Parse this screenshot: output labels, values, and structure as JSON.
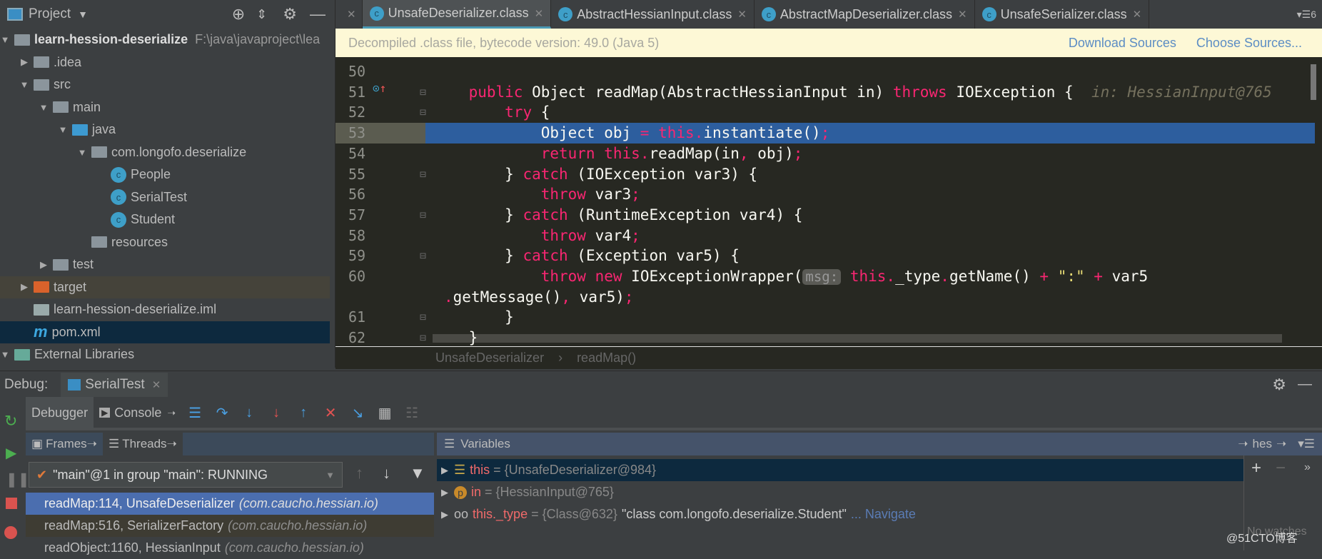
{
  "project": {
    "title": "Project",
    "tree": [
      {
        "label": "learn-hession-deserialize",
        "path": "F:\\java\\javaproject\\lea",
        "level": 0,
        "arrow": "▼",
        "icon": "module-folder-icon",
        "bold": true
      },
      {
        "label": ".idea",
        "level": 1,
        "arrow": "▶",
        "icon": "folder-icon"
      },
      {
        "label": "src",
        "level": 1,
        "arrow": "▼",
        "icon": "folder-icon"
      },
      {
        "label": "main",
        "level": 2,
        "arrow": "▼",
        "icon": "folder-icon"
      },
      {
        "label": "java",
        "level": 3,
        "arrow": "▼",
        "icon": "source-folder-icon"
      },
      {
        "label": "com.longofo.deserialize",
        "level": 4,
        "arrow": "▼",
        "icon": "package-icon"
      },
      {
        "label": "People",
        "level": 5,
        "arrow": "",
        "icon": "class-icon"
      },
      {
        "label": "SerialTest",
        "level": 5,
        "arrow": "",
        "icon": "runnable-class-icon"
      },
      {
        "label": "Student",
        "level": 5,
        "arrow": "",
        "icon": "class-icon"
      },
      {
        "label": "resources",
        "level": 4,
        "arrow": "",
        "icon": "resources-folder-icon"
      },
      {
        "label": "test",
        "level": 2,
        "arrow": "▶",
        "icon": "folder-icon"
      },
      {
        "label": "target",
        "level": 1,
        "arrow": "▶",
        "icon": "excluded-folder-icon"
      },
      {
        "label": "learn-hession-deserialize.iml",
        "level": 1,
        "arrow": "",
        "icon": "iml-file-icon"
      },
      {
        "label": "pom.xml",
        "level": 1,
        "arrow": "",
        "icon": "maven-icon",
        "selected": true
      },
      {
        "label": "External Libraries",
        "level": 0,
        "arrow": "▼",
        "icon": "libraries-icon"
      }
    ]
  },
  "tabs": [
    {
      "label": "UnsafeDeserializer.class",
      "active": true
    },
    {
      "label": "AbstractHessianInput.class"
    },
    {
      "label": "AbstractMapDeserializer.class"
    },
    {
      "label": "UnsafeSerializer.class"
    }
  ],
  "tabs_count": "6",
  "banner": {
    "text": "Decompiled .class file, bytecode version: 49.0 (Java 5)",
    "download": "Download Sources",
    "choose": "Choose Sources..."
  },
  "code": [
    {
      "n": "50",
      "t": []
    },
    {
      "n": "51",
      "t": [
        [
          "    ",
          ""
        ],
        [
          "public",
          "kw"
        ],
        [
          " Object readMap(AbstractHessianInput in) ",
          "pl"
        ],
        [
          "throws",
          "kw"
        ],
        [
          " IOException {  ",
          "pl"
        ],
        [
          "in: HessianInput@765",
          "hint"
        ]
      ]
    },
    {
      "n": "52",
      "t": [
        [
          "        ",
          ""
        ],
        [
          "try",
          "kw"
        ],
        [
          " {",
          "pl"
        ]
      ]
    },
    {
      "n": "53",
      "hl": true,
      "t": [
        [
          "            Object obj ",
          "pl"
        ],
        [
          "=",
          "kw"
        ],
        [
          " ",
          ""
        ],
        [
          "this",
          "kw"
        ],
        [
          ".",
          "kw"
        ],
        [
          "instantiate()",
          "pl"
        ],
        [
          ";",
          "kw"
        ]
      ]
    },
    {
      "n": "54",
      "t": [
        [
          "            ",
          ""
        ],
        [
          "return",
          "kw"
        ],
        [
          " ",
          ""
        ],
        [
          "this",
          "kw"
        ],
        [
          ".",
          "kw"
        ],
        [
          "readMap(in",
          "pl"
        ],
        [
          ",",
          "kw"
        ],
        [
          " obj)",
          "pl"
        ],
        [
          ";",
          "kw"
        ]
      ]
    },
    {
      "n": "55",
      "t": [
        [
          "        } ",
          "pl"
        ],
        [
          "catch",
          "kw"
        ],
        [
          " (IOException var3) {",
          "pl"
        ]
      ]
    },
    {
      "n": "56",
      "t": [
        [
          "            ",
          ""
        ],
        [
          "throw",
          "kw"
        ],
        [
          " var3",
          "pl"
        ],
        [
          ";",
          "kw"
        ]
      ]
    },
    {
      "n": "57",
      "t": [
        [
          "        } ",
          "pl"
        ],
        [
          "catch",
          "kw"
        ],
        [
          " (RuntimeException var4) {",
          "pl"
        ]
      ]
    },
    {
      "n": "58",
      "t": [
        [
          "            ",
          ""
        ],
        [
          "throw",
          "kw"
        ],
        [
          " var4",
          "pl"
        ],
        [
          ";",
          "kw"
        ]
      ]
    },
    {
      "n": "59",
      "t": [
        [
          "        } ",
          "pl"
        ],
        [
          "catch",
          "kw"
        ],
        [
          " (Exception var5) {",
          "pl"
        ]
      ]
    },
    {
      "n": "60",
      "t": [
        [
          "            ",
          ""
        ],
        [
          "throw",
          "kw"
        ],
        [
          " ",
          ""
        ],
        [
          "new",
          "kw"
        ],
        [
          " IOExceptionWrapper(",
          "pl"
        ],
        [
          "msg:",
          "pill"
        ],
        [
          " ",
          ""
        ],
        [
          "this",
          "kw"
        ],
        [
          ".",
          "kw"
        ],
        [
          "_type",
          "pl"
        ],
        [
          ".",
          "kw"
        ],
        [
          "getName() ",
          "pl"
        ],
        [
          "+",
          "kw"
        ],
        [
          " ",
          ""
        ],
        [
          "\":\"",
          "st"
        ],
        [
          " ",
          ""
        ],
        [
          "+",
          "kw"
        ],
        [
          " var5",
          "pl"
        ]
      ]
    },
    {
      "n": "",
      "wrap": true,
      "t": [
        [
          ".",
          "kw"
        ],
        [
          "getMessage()",
          "pl"
        ],
        [
          ",",
          "kw"
        ],
        [
          " var5)",
          "pl"
        ],
        [
          ";",
          "kw"
        ]
      ]
    },
    {
      "n": "61",
      "t": [
        [
          "        }",
          "pl"
        ]
      ]
    },
    {
      "n": "62",
      "t": [
        [
          "    }",
          "pl"
        ]
      ]
    }
  ],
  "breadcrumb": [
    "UnsafeDeserializer",
    "readMap()"
  ],
  "debug": {
    "label": "Debug:",
    "session": "SerialTest",
    "tabs": [
      "Debugger",
      "Console"
    ],
    "frames_tab": "Frames",
    "threads_tab": "Threads",
    "variables_title": "Variables",
    "vars_filter": "hes",
    "thread": "\"main\"@1 in group \"main\": RUNNING",
    "frames": [
      {
        "method": "readMap:114, UnsafeDeserializer",
        "pkg": "(com.caucho.hessian.io)",
        "selected": true
      },
      {
        "method": "readMap:516, SerializerFactory",
        "pkg": "(com.caucho.hessian.io)"
      },
      {
        "method": "readObject:1160, HessianInput",
        "pkg": "(com.caucho.hessian.io)"
      }
    ],
    "variables": [
      {
        "icon": "field-icon",
        "name": "this",
        "value": "{UnsafeDeserializer@984}",
        "selected": true
      },
      {
        "icon": "parameter-icon",
        "name": "in",
        "value": "{HessianInput@765}"
      },
      {
        "icon": "watch-glasses-icon",
        "name": "this._type",
        "value": "{Class@632}",
        "extra": "\"class com.longofo.deserialize.Student\"",
        "link": "... Navigate"
      }
    ],
    "watches_empty": "No watches"
  },
  "watermark": "@51CTO博客"
}
